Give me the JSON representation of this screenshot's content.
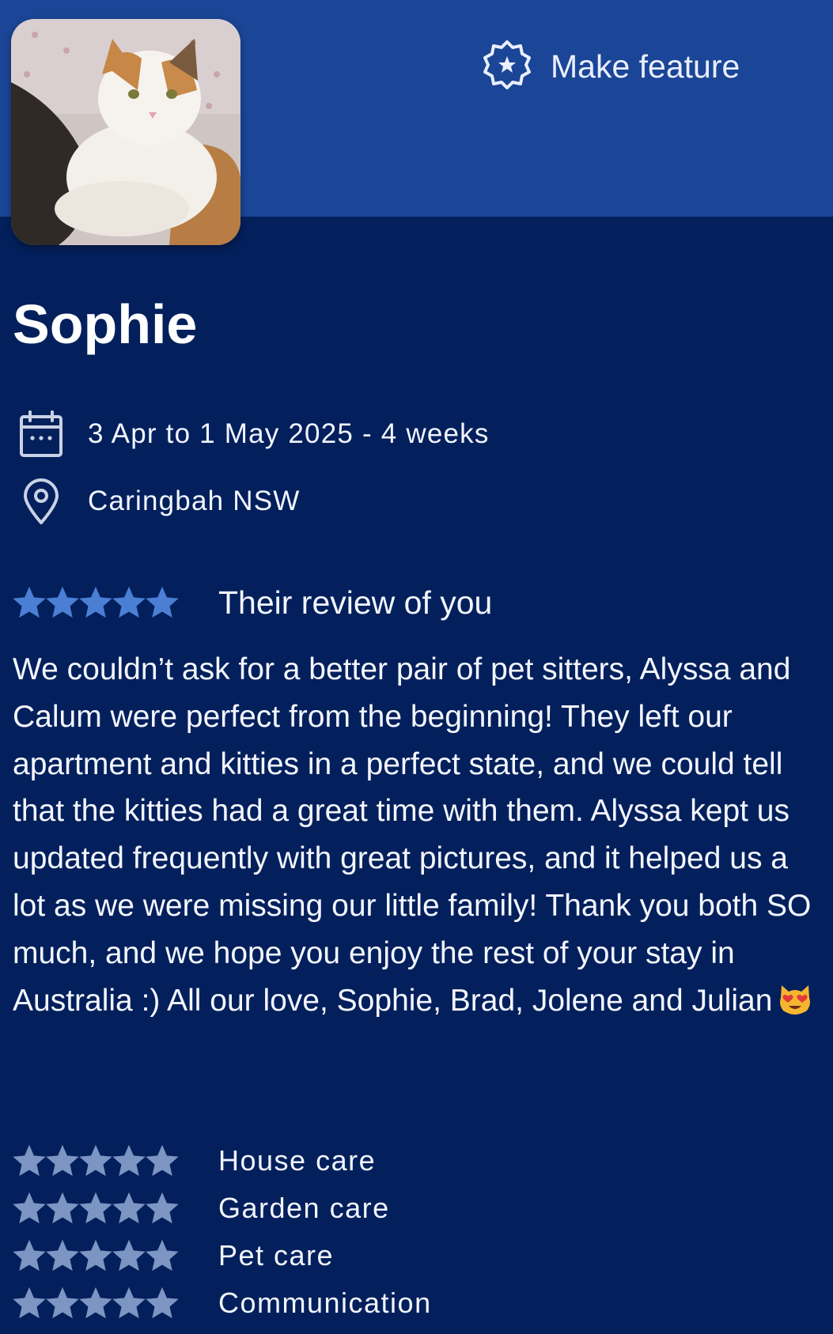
{
  "header": {
    "feature_label": "Make feature",
    "feature_icon": "star-badge-icon",
    "accent": "#1b4596",
    "background": "#03205c"
  },
  "profile": {
    "name": "Sophie",
    "avatar_icon": "cat-photo"
  },
  "stay": {
    "dates": "3 Apr to 1 May 2025 - 4 weeks",
    "date_icon": "calendar-icon",
    "location": "Caringbah NSW",
    "location_icon": "location-pin-icon"
  },
  "review": {
    "rating": 5,
    "max_rating": 5,
    "title": "Their review of you",
    "text": "We couldn’t ask for a better pair of pet sitters, Alyssa and Calum were perfect from the beginning! They left our apartment and kitties in a perfect state, and we could tell that the kitties had a great time with them. Alyssa kept us updated frequently with great pictures, and it helped us a lot as we were missing our little family! Thank you both SO much, and we hope you enjoy the rest of your stay in Australia :) All our love, Sophie, Brad, Jolene and Julian",
    "emoji": "heart-eyes-cat-emoji",
    "star_color": "#4a7fd4"
  },
  "categories": [
    {
      "label": "House care",
      "rating": 5
    },
    {
      "label": "Garden care",
      "rating": 5
    },
    {
      "label": "Pet care",
      "rating": 5
    },
    {
      "label": "Communication",
      "rating": 5
    }
  ],
  "category_star_color": "#7d95c2"
}
